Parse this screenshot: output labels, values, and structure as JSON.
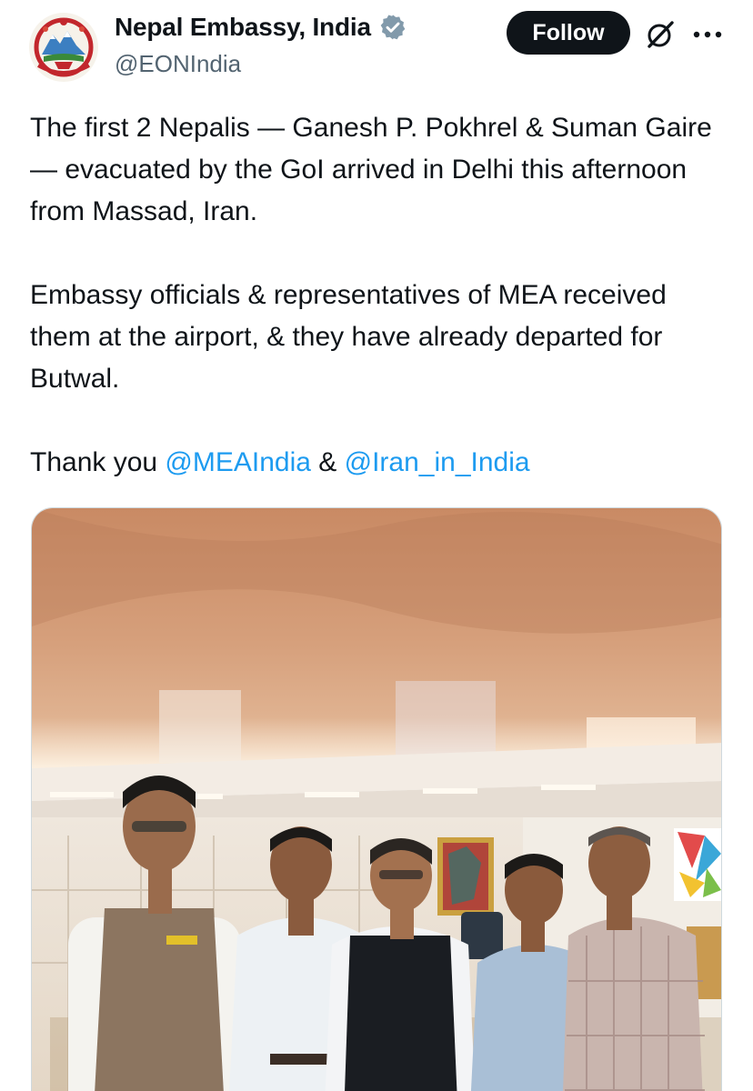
{
  "account": {
    "display_name": "Nepal Embassy, India",
    "handle": "@EONIndia",
    "avatar_icon": "nepal-emblem-icon",
    "verified_icon": "verified-badge-icon"
  },
  "actions": {
    "follow_label": "Follow",
    "grok_icon": "grok-icon",
    "more_icon": "more-icon"
  },
  "tweet": {
    "para1": "The first 2 Nepalis — Ganesh P. Pokhrel & Suman Gaire — evacuated by the GoI arrived in Delhi this afternoon from Massad, Iran.",
    "para2": "Embassy officials & representatives of MEA received them at the airport, & they have already departed for Butwal.",
    "thanks_prefix": "Thank you ",
    "mention1": "@MEAIndia",
    "thanks_joiner": " & ",
    "mention2": "@Iran_in_India"
  },
  "colors": {
    "text": "#0f1419",
    "secondary": "#536471",
    "link": "#1d9bf0",
    "verified": "#829aab"
  }
}
